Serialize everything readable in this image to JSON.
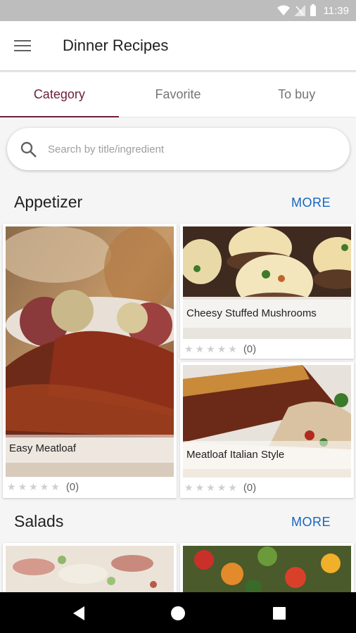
{
  "status": {
    "time": "11:39"
  },
  "appbar": {
    "title": "Dinner Recipes",
    "menu_icon": "hamburger-menu-icon"
  },
  "tabs": [
    {
      "label": "Category",
      "active": true
    },
    {
      "label": "Favorite",
      "active": false
    },
    {
      "label": "To buy",
      "active": false
    }
  ],
  "search": {
    "placeholder": "Search by title/ingredient",
    "value": ""
  },
  "sections": [
    {
      "title": "Appetizer",
      "more_label": "MORE",
      "recipes": [
        {
          "title": "Easy Meatloaf",
          "rating": 0,
          "rating_count": "(0)"
        },
        {
          "title": "Cheesy Stuffed Mushrooms",
          "rating": 0,
          "rating_count": "(0)"
        },
        {
          "title": "Meatloaf Italian Style",
          "rating": 0,
          "rating_count": "(0)"
        }
      ]
    },
    {
      "title": "Salads",
      "more_label": "MORE",
      "recipes": []
    }
  ],
  "colors": {
    "accent": "#6d2136",
    "more": "#1565c0",
    "status_bar": "#bdbdbd"
  }
}
